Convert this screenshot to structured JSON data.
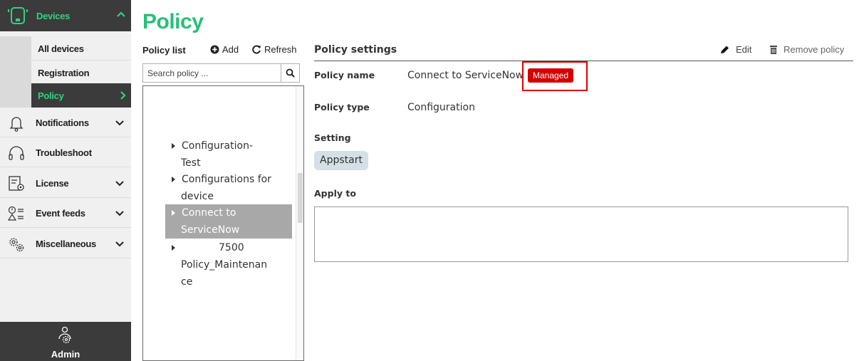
{
  "sidebar": {
    "section_title": "Devices",
    "subitems": [
      {
        "label": "All devices"
      },
      {
        "label": "Registration"
      },
      {
        "label": "Policy"
      }
    ],
    "items": [
      {
        "label": "Notifications",
        "icon": "bell-icon"
      },
      {
        "label": "Troubleshoot",
        "icon": "headset-icon"
      },
      {
        "label": "License",
        "icon": "license-icon"
      },
      {
        "label": "Event feeds",
        "icon": "event-feeds-icon"
      },
      {
        "label": "Miscellaneous",
        "icon": "gears-icon"
      }
    ],
    "admin_label": "Admin"
  },
  "page": {
    "title": "Policy"
  },
  "policy_list": {
    "title": "Policy list",
    "add_label": "Add",
    "refresh_label": "Refresh",
    "search_placeholder": "Search policy ...",
    "items": [
      {
        "line1": "Configuration-",
        "line2": "Test"
      },
      {
        "line1": "Configurations for",
        "line2": "device"
      },
      {
        "line1": "Connect to",
        "line2": "ServiceNow",
        "selected": true
      },
      {
        "line1": "7500",
        "line2": "Policy_Maintenan",
        "line3": "ce"
      }
    ]
  },
  "settings": {
    "title": "Policy settings",
    "edit_label": "Edit",
    "remove_label": "Remove policy",
    "policy_name_label": "Policy name",
    "policy_name_value": "Connect to ServiceNow",
    "managed_badge": "Managed",
    "policy_type_label": "Policy type",
    "policy_type_value": "Configuration",
    "setting_label": "Setting",
    "setting_chip": "Appstart",
    "apply_to_label": "Apply to"
  },
  "colors": {
    "accent_green": "#25c07a",
    "sidebar_dark": "#3b3b3b",
    "managed_red": "#d40000",
    "selected_row": "#a8a8a8"
  }
}
